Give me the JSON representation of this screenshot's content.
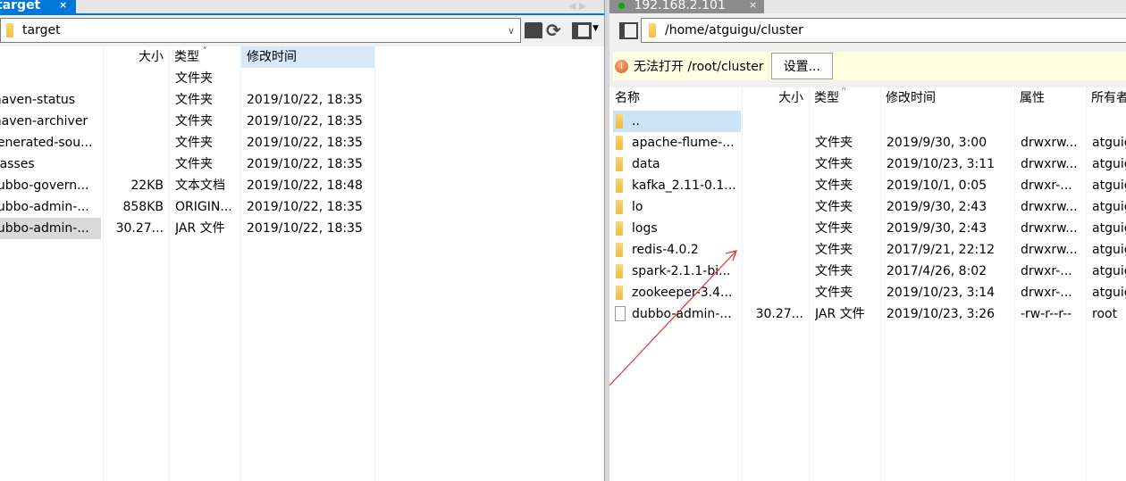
{
  "left": {
    "tab_label": "target",
    "tab_close": "×",
    "path": "target",
    "headers": {
      "name": "",
      "size": "大小",
      "type": "类型",
      "modified": "修改时间"
    },
    "rows": [
      {
        "name": "",
        "size": "",
        "type": "文件夹",
        "modified": "",
        "icon": "parent"
      },
      {
        "name": "maven-status",
        "size": "",
        "type": "文件夹",
        "modified": "2019/10/22, 18:35",
        "icon": "folder"
      },
      {
        "name": "maven-archiver",
        "size": "",
        "type": "文件夹",
        "modified": "2019/10/22, 18:35",
        "icon": "folder"
      },
      {
        "name": "generated-sou...",
        "size": "",
        "type": "文件夹",
        "modified": "2019/10/22, 18:35",
        "icon": "folder"
      },
      {
        "name": "classes",
        "size": "",
        "type": "文件夹",
        "modified": "2019/10/22, 18:35",
        "icon": "folder"
      },
      {
        "name": "dubbo-govern...",
        "size": "22KB",
        "type": "文本文档",
        "modified": "2019/10/22, 18:48",
        "icon": "file"
      },
      {
        "name": "dubbo-admin-...",
        "size": "858KB",
        "type": "ORIGIN...",
        "modified": "2019/10/22, 18:35",
        "icon": "file"
      },
      {
        "name": "dubbo-admin-...",
        "size": "30.27...",
        "type": "JAR 文件",
        "modified": "2019/10/22, 18:35",
        "icon": "file",
        "selected": true
      }
    ]
  },
  "right": {
    "tab_label": "192.168.2.101",
    "tab_close": "×",
    "connection_status_color": "#00b000",
    "path": "/home/atguigu/cluster",
    "warning": {
      "text": "无法打开 /root/cluster",
      "button": "设置..."
    },
    "headers": {
      "name": "名称",
      "size": "大小",
      "type": "类型",
      "modified": "修改时间",
      "attributes": "属性",
      "owner": "所有者"
    },
    "rows": [
      {
        "name": "..",
        "size": "",
        "type": "",
        "modified": "",
        "attributes": "",
        "owner": "",
        "icon": "folder",
        "selected": true
      },
      {
        "name": "apache-flume-...",
        "size": "",
        "type": "文件夹",
        "modified": "2019/9/30, 3:00",
        "attributes": "drwxrw...",
        "owner": "atguigu",
        "icon": "folder"
      },
      {
        "name": "data",
        "size": "",
        "type": "文件夹",
        "modified": "2019/10/23, 3:11",
        "attributes": "drwxrw...",
        "owner": "atguigu",
        "icon": "folder"
      },
      {
        "name": "kafka_2.11-0.1...",
        "size": "",
        "type": "文件夹",
        "modified": "2019/10/1, 0:05",
        "attributes": "drwxr-...",
        "owner": "atguigu",
        "icon": "folder"
      },
      {
        "name": "lo",
        "size": "",
        "type": "文件夹",
        "modified": "2019/9/30, 2:43",
        "attributes": "drwxrw...",
        "owner": "atguigu",
        "icon": "folder"
      },
      {
        "name": "logs",
        "size": "",
        "type": "文件夹",
        "modified": "2019/9/30, 2:43",
        "attributes": "drwxrw...",
        "owner": "atguigu",
        "icon": "folder"
      },
      {
        "name": "redis-4.0.2",
        "size": "",
        "type": "文件夹",
        "modified": "2017/9/21, 22:12",
        "attributes": "drwxrw...",
        "owner": "atguigu",
        "icon": "folder"
      },
      {
        "name": "spark-2.1.1-bi...",
        "size": "",
        "type": "文件夹",
        "modified": "2017/4/26, 8:02",
        "attributes": "drwxr-...",
        "owner": "atguigu",
        "icon": "folder"
      },
      {
        "name": "zookeeper-3.4...",
        "size": "",
        "type": "文件夹",
        "modified": "2019/10/23, 3:14",
        "attributes": "drwxr-...",
        "owner": "atguigu",
        "icon": "folder"
      },
      {
        "name": "dubbo-admin-...",
        "size": "30.27...",
        "type": "JAR 文件",
        "modified": "2019/10/23, 3:26",
        "attributes": "-rw-r--r--",
        "owner": "root",
        "icon": "file"
      }
    ]
  },
  "annotation_color": "#e53030",
  "accent": "#0078d7"
}
